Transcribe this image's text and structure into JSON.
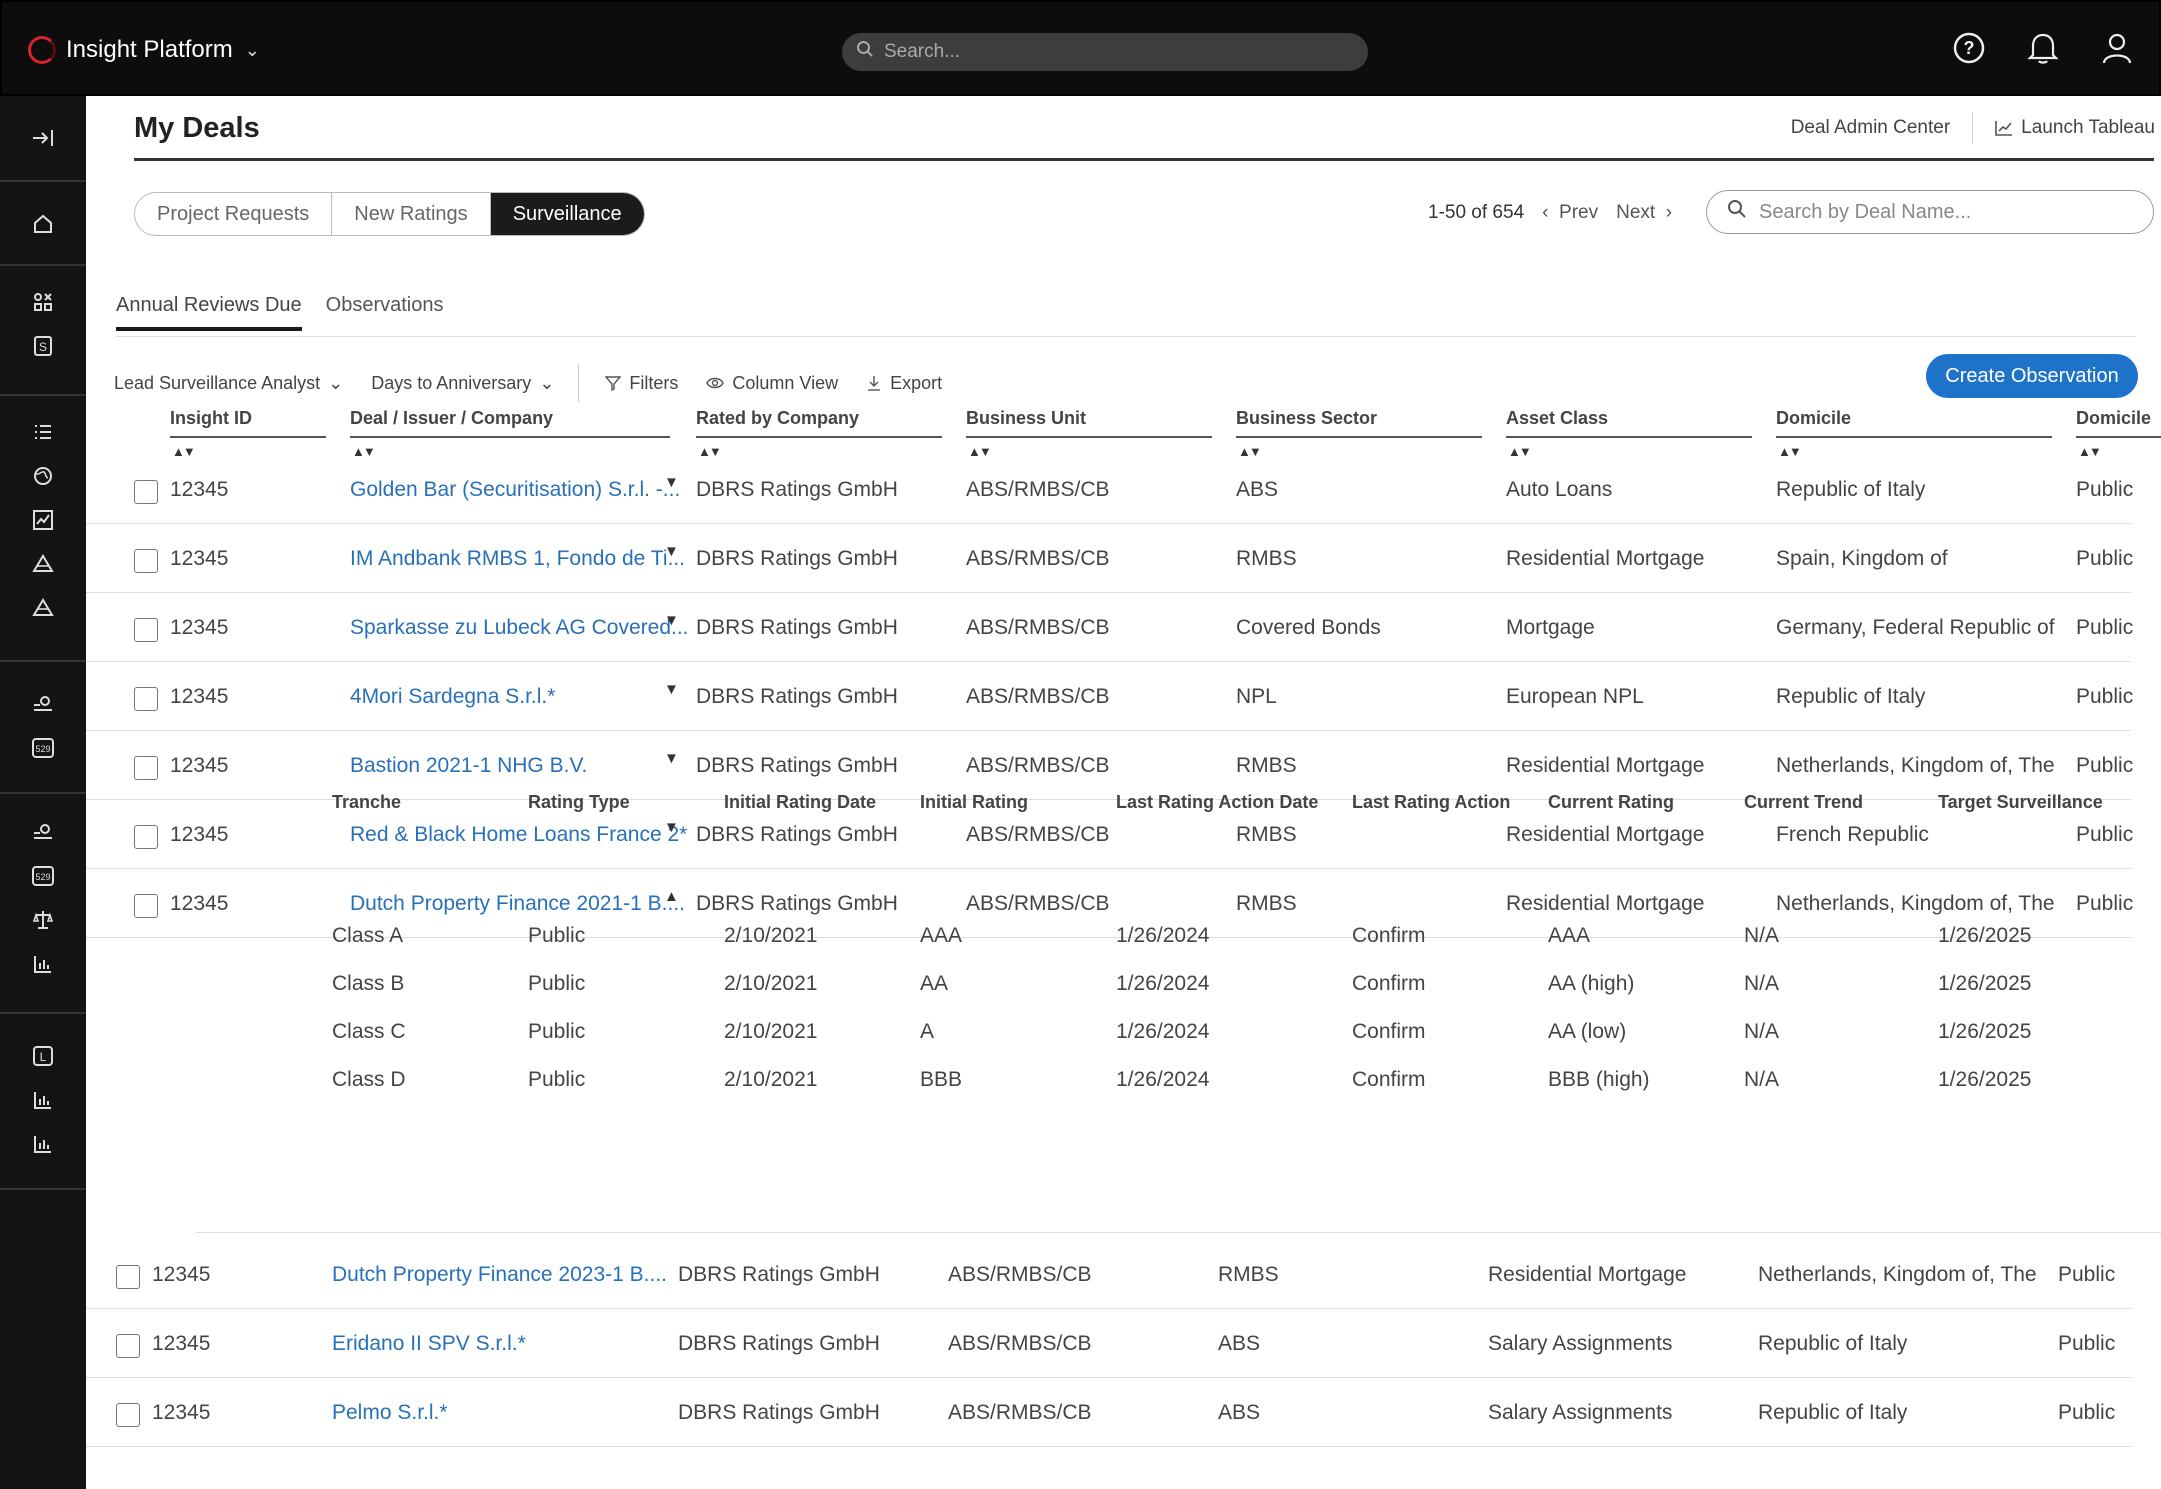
{
  "app": {
    "name": "Insight Platform",
    "search_placeholder": "Search..."
  },
  "icons": {
    "help": "help-circle-icon",
    "bell": "bell-icon",
    "user": "user-icon"
  },
  "page": {
    "title": "My Deals",
    "links": {
      "deal_admin": "Deal Admin Center",
      "tableau": "Launch Tableau"
    },
    "segments": [
      "Project Requests",
      "New Ratings",
      "Surveillance"
    ],
    "active_segment": "Surveillance",
    "pager": {
      "range": "1-50 of 654",
      "prev": "Prev",
      "next": "Next"
    },
    "deal_search_placeholder": "Search by Deal Name...",
    "subtabs": [
      "Annual Reviews Due",
      "Observations"
    ],
    "toolbar": {
      "analyst": "Lead Surveillance Analyst",
      "days": "Days to Anniversary",
      "filters": "Filters",
      "column_view": "Column View",
      "export": "Export",
      "create": "Create Observation"
    }
  },
  "columns": [
    "Insight ID",
    "Deal / Issuer / Company",
    "Rated by Company",
    "Business Unit",
    "Business Sector",
    "Asset Class",
    "Domicile",
    "Domicile"
  ],
  "rows": [
    {
      "id": "12345",
      "deal": "Golden Bar (Securitisation) S.r.l. -...",
      "rated_by": "DBRS Ratings GmbH",
      "unit": "ABS/RMBS/CB",
      "sector": "ABS",
      "asset": "Auto Loans",
      "domicile": "Republic of Italy",
      "visibility": "Public",
      "caret": "▼"
    },
    {
      "id": "12345",
      "deal": "IM Andbank RMBS 1, Fondo de Ti...",
      "rated_by": "DBRS Ratings GmbH",
      "unit": "ABS/RMBS/CB",
      "sector": "RMBS",
      "asset": "Residential Mortgage",
      "domicile": "Spain, Kingdom of",
      "visibility": "Public",
      "caret": "▼"
    },
    {
      "id": "12345",
      "deal": "Sparkasse zu Lubeck AG Covered...",
      "rated_by": "DBRS Ratings GmbH",
      "unit": "ABS/RMBS/CB",
      "sector": "Covered Bonds",
      "asset": "Mortgage",
      "domicile": "Germany, Federal Republic of",
      "visibility": "Public",
      "caret": "▼"
    },
    {
      "id": "12345",
      "deal": "4Mori Sardegna S.r.l.*",
      "rated_by": "DBRS Ratings GmbH",
      "unit": "ABS/RMBS/CB",
      "sector": "NPL",
      "asset": "European NPL",
      "domicile": "Republic of Italy",
      "visibility": "Public",
      "caret": "▼"
    },
    {
      "id": "12345",
      "deal": "Bastion 2021-1 NHG B.V.",
      "rated_by": "DBRS Ratings GmbH",
      "unit": "ABS/RMBS/CB",
      "sector": "RMBS",
      "asset": "Residential Mortgage",
      "domicile": "Netherlands, Kingdom of, The",
      "visibility": "Public",
      "caret": "▼"
    },
    {
      "id": "12345",
      "deal": "Red & Black Home Loans France 2*",
      "rated_by": "DBRS Ratings GmbH",
      "unit": "ABS/RMBS/CB",
      "sector": "RMBS",
      "asset": "Residential Mortgage",
      "domicile": "French Republic",
      "visibility": "Public",
      "caret": "▼"
    },
    {
      "id": "12345",
      "deal": "Dutch Property Finance 2021-1 B....",
      "rated_by": "DBRS Ratings GmbH",
      "unit": "ABS/RMBS/CB",
      "sector": "RMBS",
      "asset": "Residential Mortgage",
      "domicile": "Netherlands, Kingdom of, The",
      "visibility": "Public",
      "caret": "▲"
    }
  ],
  "tranche_columns": [
    "Tranche",
    "Rating Type",
    "Initial Rating Date",
    "Initial Rating",
    "Last Rating Action Date",
    "Last Rating Action",
    "Current Rating",
    "Current Trend",
    "Target Surveillance"
  ],
  "tranches": [
    [
      "Class A",
      "Public",
      "2/10/2021",
      "AAA",
      "1/26/2024",
      "Confirm",
      "AAA",
      "N/A",
      "1/26/2025"
    ],
    [
      "Class B",
      "Public",
      "2/10/2021",
      "AA",
      "1/26/2024",
      "Confirm",
      "AA (high)",
      "N/A",
      "1/26/2025"
    ],
    [
      "Class C",
      "Public",
      "2/10/2021",
      "A",
      "1/26/2024",
      "Confirm",
      "AA (low)",
      "N/A",
      "1/26/2025"
    ],
    [
      "Class D",
      "Public",
      "2/10/2021",
      "BBB",
      "1/26/2024",
      "Confirm",
      "BBB (high)",
      "N/A",
      "1/26/2025"
    ]
  ],
  "rows_after": [
    {
      "id": "12345",
      "deal": "Dutch Property Finance 2023-1 B....",
      "rated_by": "DBRS Ratings GmbH",
      "unit": "ABS/RMBS/CB",
      "sector": "RMBS",
      "asset": "Residential Mortgage",
      "domicile": "Netherlands, Kingdom of, The",
      "visibility": "Public"
    },
    {
      "id": "12345",
      "deal": "Eridano II SPV S.r.l.*",
      "rated_by": "DBRS Ratings GmbH",
      "unit": "ABS/RMBS/CB",
      "sector": "ABS",
      "asset": "Salary Assignments",
      "domicile": "Republic of Italy",
      "visibility": "Public"
    },
    {
      "id": "12345",
      "deal": "Pelmo S.r.l.*",
      "rated_by": "DBRS Ratings GmbH",
      "unit": "ABS/RMBS/CB",
      "sector": "ABS",
      "asset": "Salary Assignments",
      "domicile": "Republic of Italy",
      "visibility": "Public"
    }
  ]
}
